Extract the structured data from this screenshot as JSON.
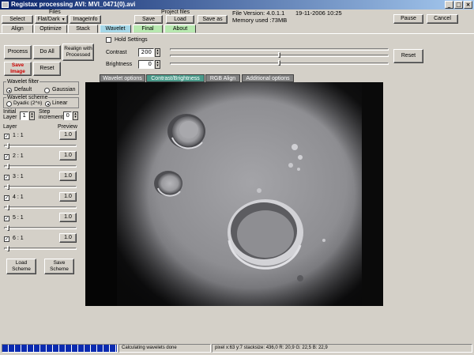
{
  "window": {
    "title": "Registax processing AVI: MVI_0471(0).avi"
  },
  "toolbar": {
    "files_label": "Files",
    "select": "Select",
    "flatdark": "Flat/Dark",
    "imageinfo": "ImageInfo",
    "project_files_label": "Project files",
    "save": "Save",
    "load": "Load",
    "save_as": "Save as",
    "file_version": "File Version: 4.0.1.1",
    "date": "19-11-2006 10:25",
    "memory": "Memory used :73MB",
    "pause": "Pause",
    "cancel": "Cancel"
  },
  "tabs": [
    {
      "label": "Align"
    },
    {
      "label": "Optimize"
    },
    {
      "label": "Stack"
    },
    {
      "label": "Wavelet"
    },
    {
      "label": "Final"
    },
    {
      "label": "About"
    }
  ],
  "actions": {
    "process": "Process",
    "do_all": "Do All",
    "realign": "Realign with Processed",
    "save_image": "Save Image",
    "reset": "Reset"
  },
  "adjust": {
    "hold_settings": "Hold Settings",
    "contrast_label": "Contrast",
    "contrast_value": "200",
    "contrast_level": 200,
    "brightness_label": "Brightness",
    "brightness_value": "0",
    "brightness_level": 0,
    "reset": "Reset"
  },
  "subtabs": [
    {
      "label": "Wavelet options"
    },
    {
      "label": "Contrast/Brightness"
    },
    {
      "label": "RGB Align"
    },
    {
      "label": "Additional options"
    }
  ],
  "wavelet": {
    "filter_title": "Wavelet filter",
    "default": "Default",
    "gaussian": "Gaussian",
    "scheme_title": "Wavelet scheme",
    "dyadic": "Dyadic (2^n)",
    "linear": "Linear",
    "initial_layer_label": "Initial Layer",
    "initial_layer_value": "1",
    "step_increment_label": "Step increment",
    "step_increment_value": "0",
    "layer_header": "Layer",
    "preview_header": "Preview",
    "layers": [
      {
        "label": "1 : 1",
        "preview": "1.0"
      },
      {
        "label": "2 : 1",
        "preview": "1.0"
      },
      {
        "label": "3 : 1",
        "preview": "1.0"
      },
      {
        "label": "4 : 1",
        "preview": "1.0"
      },
      {
        "label": "5 : 1",
        "preview": "1.0"
      },
      {
        "label": "6 : 1",
        "preview": "1.0"
      }
    ],
    "load_scheme": "Load Scheme",
    "save_scheme": "Save Scheme"
  },
  "status": {
    "message": "Calculating wavelets done",
    "pixel_info": "pixel x:63 y:7 stacksize: 436,0 R: 20,9 G: 22,5 B: 22,9",
    "progress_fraction": 1.0
  },
  "colors": {
    "title_start": "#0a246a",
    "title_end": "#a6caf0",
    "save_image_text": "#cc0000",
    "progress": "#0a2ab0",
    "subtab_active": "#4a9a8a"
  }
}
